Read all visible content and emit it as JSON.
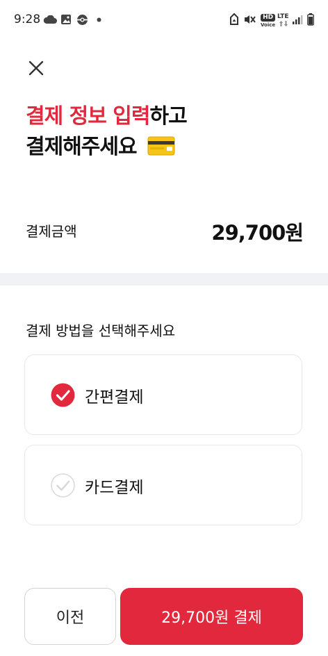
{
  "status_bar": {
    "time": "9:28",
    "hd_top": "HD",
    "hd_bottom": "Voice",
    "network": "LTE"
  },
  "header": {
    "title_accent": "결제 정보 입력",
    "title_rest": "하고",
    "title_line2": "결제해주세요",
    "emoji_icon": "credit-card-icon"
  },
  "amount": {
    "label": "결제금액",
    "value": "29,700원"
  },
  "payment_method": {
    "title": "결제 방법을 선택해주세요",
    "options": [
      {
        "label": "간편결제",
        "selected": true
      },
      {
        "label": "카드결제",
        "selected": false
      }
    ]
  },
  "footer": {
    "prev_label": "이전",
    "pay_label": "29,700원 결제"
  },
  "colors": {
    "accent": "#e2283c",
    "divider": "#f1f2f5",
    "border": "#e6e7ea"
  }
}
